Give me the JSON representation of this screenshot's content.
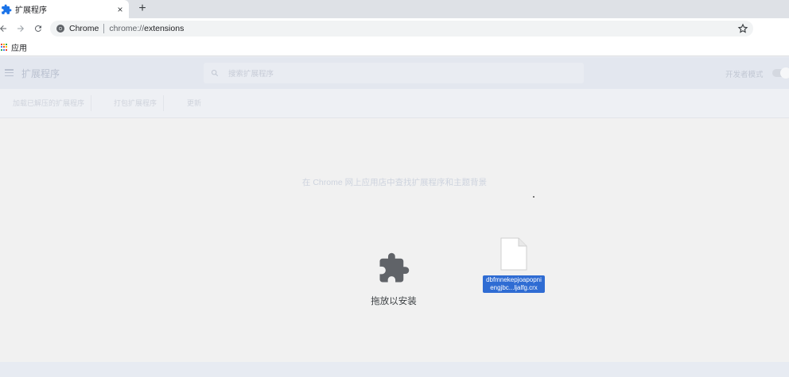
{
  "tab": {
    "title": "扩展程序",
    "close": "×",
    "new_tab": "+"
  },
  "toolbar": {
    "site_name": "Chrome",
    "url_scheme": "chrome://",
    "url_path": "extensions"
  },
  "bookmarks": {
    "apps_label": "应用"
  },
  "extensions": {
    "title": "扩展程序",
    "search_placeholder": "搜索扩展程序",
    "developer_mode_label": "开发者模式",
    "developer_mode_on": false,
    "buttons": {
      "load_unpacked": "加载已解压的扩展程序",
      "pack": "打包扩展程序",
      "update": "更新"
    },
    "store_link": "在 Chrome 网上应用店中查找扩展程序和主题背景"
  },
  "drop_zone": {
    "label": "拖放以安装"
  },
  "dragged_file": {
    "name": "dbfmnekepjoapopniengjbc...ljalfg.crx"
  },
  "colors": {
    "accent": "#1a73e8",
    "selection": "#2f6cd3"
  }
}
